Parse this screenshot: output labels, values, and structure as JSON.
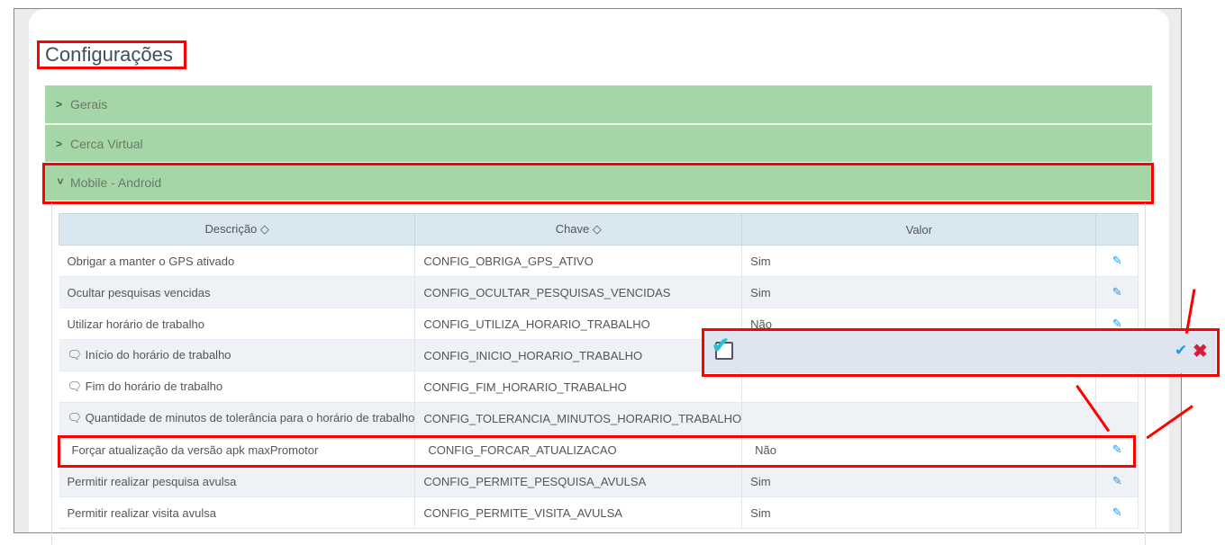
{
  "page": {
    "title": "Configurações"
  },
  "accordion": [
    {
      "label": "Gerais",
      "expanded": false
    },
    {
      "label": "Cerca Virtual",
      "expanded": false
    },
    {
      "label": "Mobile - Android",
      "expanded": true
    }
  ],
  "table": {
    "headers": [
      "Descrição",
      "Chave",
      "Valor"
    ],
    "sort_icon": "sort-icon",
    "rows": [
      {
        "desc": "Obrigar a manter o GPS ativado",
        "key": "CONFIG_OBRIGA_GPS_ATIVO",
        "value": "Sim",
        "comment": false
      },
      {
        "desc": "Ocultar pesquisas vencidas",
        "key": "CONFIG_OCULTAR_PESQUISAS_VENCIDAS",
        "value": "Sim",
        "comment": false
      },
      {
        "desc": "Utilizar horário de trabalho",
        "key": "CONFIG_UTILIZA_HORARIO_TRABALHO",
        "value": "Não",
        "comment": false
      },
      {
        "desc": "Início do horário de trabalho",
        "key": "CONFIG_INICIO_HORARIO_TRABALHO",
        "value": "",
        "comment": true
      },
      {
        "desc": "Fim do horário de trabalho",
        "key": "CONFIG_FIM_HORARIO_TRABALHO",
        "value": "",
        "comment": true
      },
      {
        "desc": "Quantidade de minutos de tolerância para o horário de trabalho",
        "key": "CONFIG_TOLERANCIA_MINUTOS_HORARIO_TRABALHO",
        "value": "",
        "comment": true
      },
      {
        "desc": "Forçar atualização da versão apk maxPromotor",
        "key": "CONFIG_FORCAR_ATUALIZACAO",
        "value": "Não",
        "comment": false
      },
      {
        "desc": "Permitir realizar pesquisa avulsa",
        "key": "CONFIG_PERMITE_PESQUISA_AVULSA",
        "value": "Sim",
        "comment": false
      },
      {
        "desc": "Permitir realizar visita avulsa",
        "key": "CONFIG_PERMITE_VISITA_AVULSA",
        "value": "Sim",
        "comment": false
      }
    ]
  },
  "editor": {
    "checked": true
  },
  "colors": {
    "accordion": "#a5d6a7",
    "header": "#d9e7f0",
    "annotation": "#ff0000",
    "confirm": "#1e9be8",
    "cancel": "#d0213f"
  }
}
